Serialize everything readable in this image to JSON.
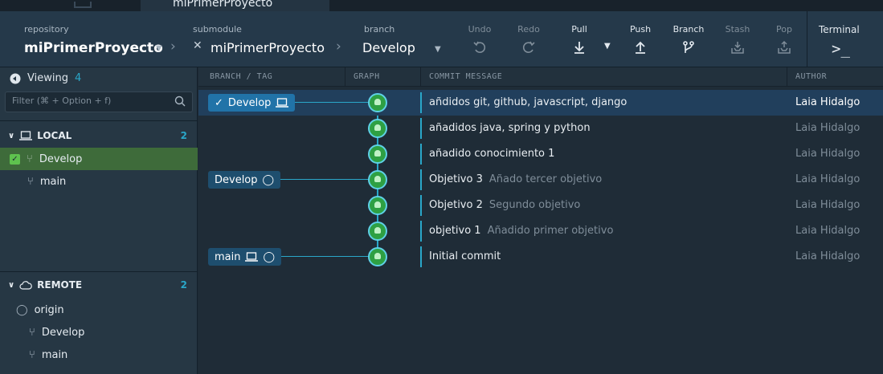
{
  "window": {
    "tab_title": "miPrimerProyecto"
  },
  "toolbar": {
    "repository_label": "repository",
    "repository_value": "miPrimerProyecto",
    "submodule_label": "submodule",
    "submodule_value": "miPrimerProyecto",
    "branch_label": "branch",
    "branch_value": "Develop",
    "actions": [
      {
        "label": "Undo",
        "icon": "undo-icon",
        "enabled": false
      },
      {
        "label": "Redo",
        "icon": "redo-icon",
        "enabled": false
      },
      {
        "label": "Pull",
        "icon": "pull-icon",
        "enabled": true
      },
      {
        "label": "Push",
        "icon": "push-icon",
        "enabled": true
      },
      {
        "label": "Branch",
        "icon": "branch-icon",
        "enabled": true
      },
      {
        "label": "Stash",
        "icon": "stash-icon",
        "enabled": false
      },
      {
        "label": "Pop",
        "icon": "pop-icon",
        "enabled": false
      }
    ],
    "terminal_label": "Terminal",
    "terminal_prompt": ">_"
  },
  "sidebar": {
    "viewing_label": "Viewing",
    "viewing_count": "4",
    "filter_placeholder": "Filter (⌘ + Option + f)",
    "local": {
      "label": "LOCAL",
      "count": "2",
      "branches": [
        {
          "name": "Develop",
          "checked": true
        },
        {
          "name": "main",
          "checked": false
        }
      ]
    },
    "remote": {
      "label": "REMOTE",
      "count": "2",
      "origin": "origin",
      "branches": [
        {
          "name": "Develop"
        },
        {
          "name": "main"
        }
      ]
    }
  },
  "graph": {
    "columns": {
      "branch_tag": "BRANCH / TAG",
      "graph": "GRAPH",
      "commit_message": "COMMIT MESSAGE",
      "author": "AUTHOR"
    },
    "refs": {
      "develop_current": "Develop",
      "develop_remote": "Develop",
      "main": "main"
    },
    "commits": [
      {
        "title": "añdidos git, github, javascript, django",
        "description": "",
        "author": "Laia Hidalgo"
      },
      {
        "title": "añadidos java, spring y python",
        "description": "",
        "author": "Laia Hidalgo"
      },
      {
        "title": "añadido conocimiento 1",
        "description": "",
        "author": "Laia Hidalgo"
      },
      {
        "title": "Objetivo 3",
        "description": "Añado tercer objetivo",
        "author": "Laia Hidalgo"
      },
      {
        "title": "Objetivo 2",
        "description": "Segundo objetivo",
        "author": "Laia Hidalgo"
      },
      {
        "title": "objetivo 1",
        "description": "Añadido primer objetivo",
        "author": "Laia Hidalgo"
      },
      {
        "title": "Initial commit",
        "description": "",
        "author": "Laia Hidalgo"
      }
    ]
  },
  "colors": {
    "accent": "#2aa7c9",
    "selected_row": "#213f5c",
    "active_branch": "#3e6b3a",
    "node": "#2ea043"
  }
}
